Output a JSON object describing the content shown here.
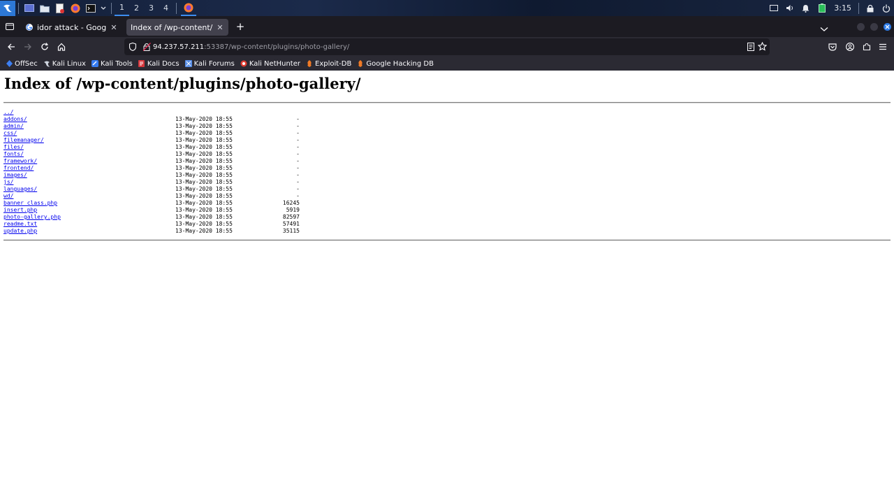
{
  "panel": {
    "workspaces": [
      "1",
      "2",
      "3",
      "4"
    ],
    "clock": "3:15"
  },
  "tabs": [
    {
      "title": "idor attack - Google Search",
      "active": false
    },
    {
      "title": "Index of /wp-content/plugins/photo-gallery/",
      "active": true
    }
  ],
  "urlbar": {
    "host": "94.237.57.211",
    "path": ":53387/wp-content/plugins/photo-gallery/"
  },
  "bookmarks": [
    {
      "label": "OffSec",
      "icon": "offsec-icon"
    },
    {
      "label": "Kali Linux",
      "icon": "kali-dragon-icon"
    },
    {
      "label": "Kali Tools",
      "icon": "kali-tools-icon"
    },
    {
      "label": "Kali Docs",
      "icon": "kali-docs-icon"
    },
    {
      "label": "Kali Forums",
      "icon": "kali-forums-icon"
    },
    {
      "label": "Kali NetHunter",
      "icon": "nethunter-icon"
    },
    {
      "label": "Exploit-DB",
      "icon": "exploit-db-icon"
    },
    {
      "label": "Google Hacking DB",
      "icon": "ghdb-icon"
    }
  ],
  "page": {
    "title": "Index of /wp-content/plugins/photo-gallery/",
    "parent": "../",
    "entries": [
      {
        "name": "addons/",
        "date": "13-May-2020 18:55",
        "size": "-"
      },
      {
        "name": "admin/",
        "date": "13-May-2020 18:55",
        "size": "-"
      },
      {
        "name": "css/",
        "date": "13-May-2020 18:55",
        "size": "-"
      },
      {
        "name": "filemanager/",
        "date": "13-May-2020 18:55",
        "size": "-"
      },
      {
        "name": "files/",
        "date": "13-May-2020 18:55",
        "size": "-"
      },
      {
        "name": "fonts/",
        "date": "13-May-2020 18:55",
        "size": "-"
      },
      {
        "name": "framework/",
        "date": "13-May-2020 18:55",
        "size": "-"
      },
      {
        "name": "frontend/",
        "date": "13-May-2020 18:55",
        "size": "-"
      },
      {
        "name": "images/",
        "date": "13-May-2020 18:55",
        "size": "-"
      },
      {
        "name": "js/",
        "date": "13-May-2020 18:55",
        "size": "-"
      },
      {
        "name": "languages/",
        "date": "13-May-2020 18:55",
        "size": "-"
      },
      {
        "name": "wd/",
        "date": "13-May-2020 18:55",
        "size": "-"
      },
      {
        "name": "banner_class.php",
        "date": "13-May-2020 18:55",
        "size": "16245"
      },
      {
        "name": "insert.php",
        "date": "13-May-2020 18:55",
        "size": "5919"
      },
      {
        "name": "photo-gallery.php",
        "date": "13-May-2020 18:55",
        "size": "82597"
      },
      {
        "name": "readme.txt",
        "date": "13-May-2020 18:55",
        "size": "57491"
      },
      {
        "name": "update.php",
        "date": "13-May-2020 18:55",
        "size": "35115"
      }
    ]
  }
}
